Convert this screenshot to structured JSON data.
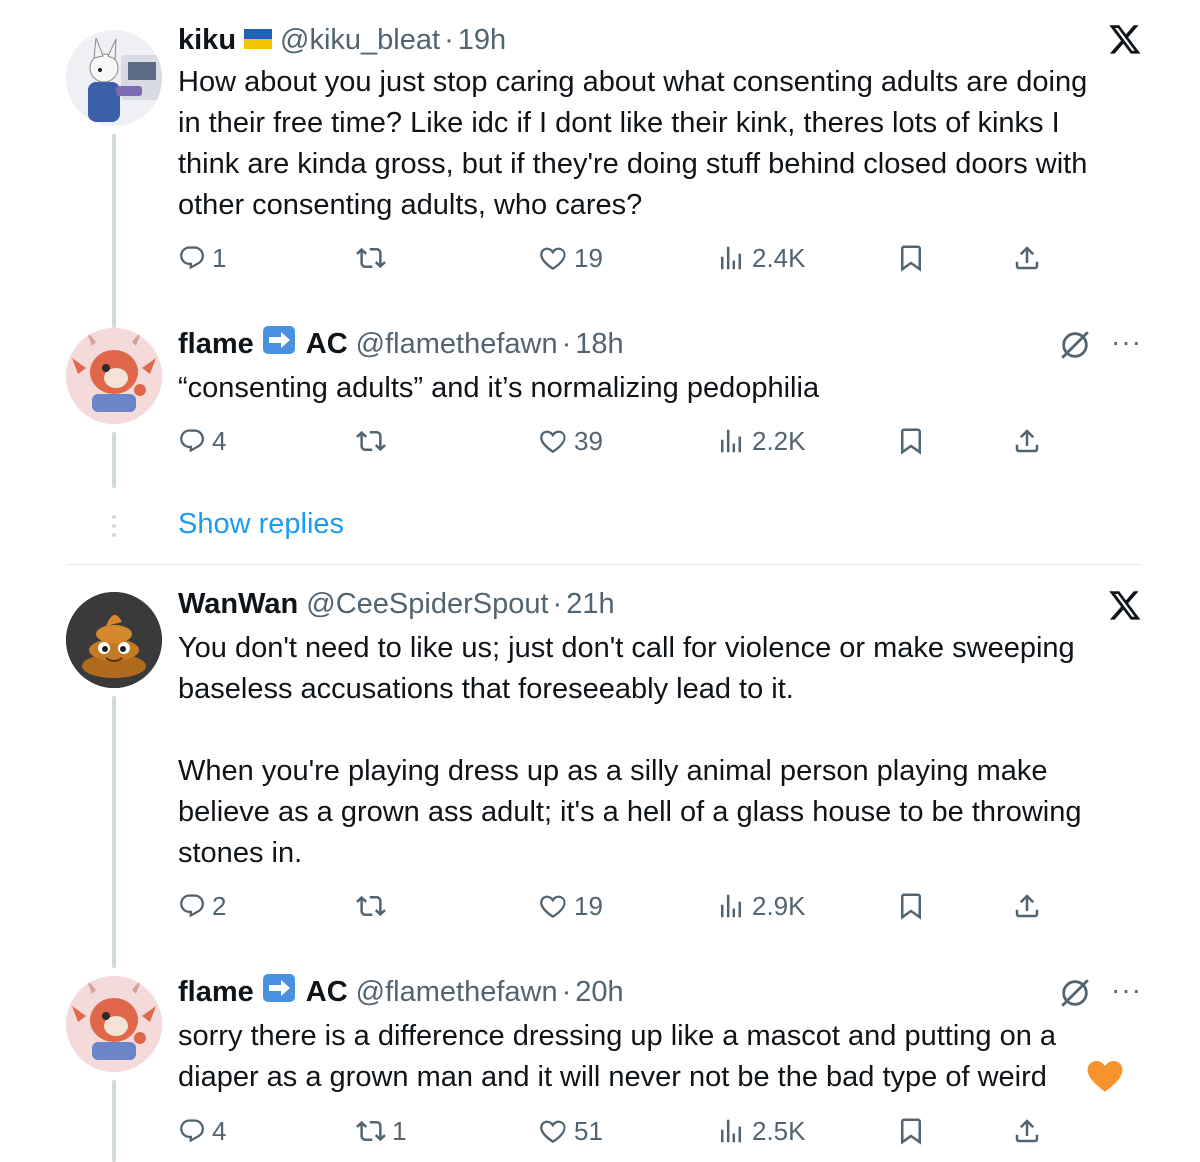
{
  "tweets": [
    {
      "name": "kiku",
      "handle": "@kiku_bleat",
      "time": "19h",
      "text": "How about you just stop caring about what consenting adults are doing\nin their free time? Like idc if I dont like their kink, theres lots of kinks I\nthink are kinda gross, but if they're doing stuff behind closed doors with\nother consenting adults, who cares?",
      "replies": "1",
      "reposts": "",
      "likes": "19",
      "views": "2.4K"
    },
    {
      "name": "flame",
      "name_suffix": "AC",
      "handle": "@flamethefawn",
      "time": "18h",
      "text": "“consenting adults” and it’s normalizing pedophilia",
      "replies": "4",
      "reposts": "",
      "likes": "39",
      "views": "2.2K"
    },
    {
      "name": "WanWan",
      "handle": "@CeeSpiderSpout",
      "time": "21h",
      "text": "You don't need to like us; just don't call for violence or make sweeping\nbaseless accusations that foreseeably lead to it.\n\nWhen you're playing dress up as a silly animal person playing make\nbelieve as a grown ass adult; it's a hell of a glass house to be throwing\nstones in.",
      "replies": "2",
      "reposts": "",
      "likes": "19",
      "views": "2.9K"
    },
    {
      "name": "flame",
      "name_suffix": "AC",
      "handle": "@flamethefawn",
      "time": "20h",
      "text": "sorry there is a difference dressing up like a mascot and putting on a\ndiaper as a grown man and it will never not be the bad type of weird",
      "replies": "4",
      "reposts": "1",
      "likes": "51",
      "views": "2.5K"
    }
  ],
  "show_replies_label": "Show replies",
  "separator": "·",
  "more_label": "···",
  "icons": {
    "reply": "reply-icon",
    "repost": "repost-icon",
    "like": "heart-icon",
    "views": "views-icon",
    "bookmark": "bookmark-icon",
    "share": "share-icon",
    "x_logo": "x-logo-icon",
    "mute": "mute-icon",
    "flag": "ukraine-flag-icon",
    "arrow": "right-arrow-emoji-icon",
    "heart_emoji": "orange-heart-emoji-icon"
  },
  "colors": {
    "text": "#0f1419",
    "muted": "#536471",
    "link": "#1d9bf0",
    "thread": "#cfd9de"
  }
}
